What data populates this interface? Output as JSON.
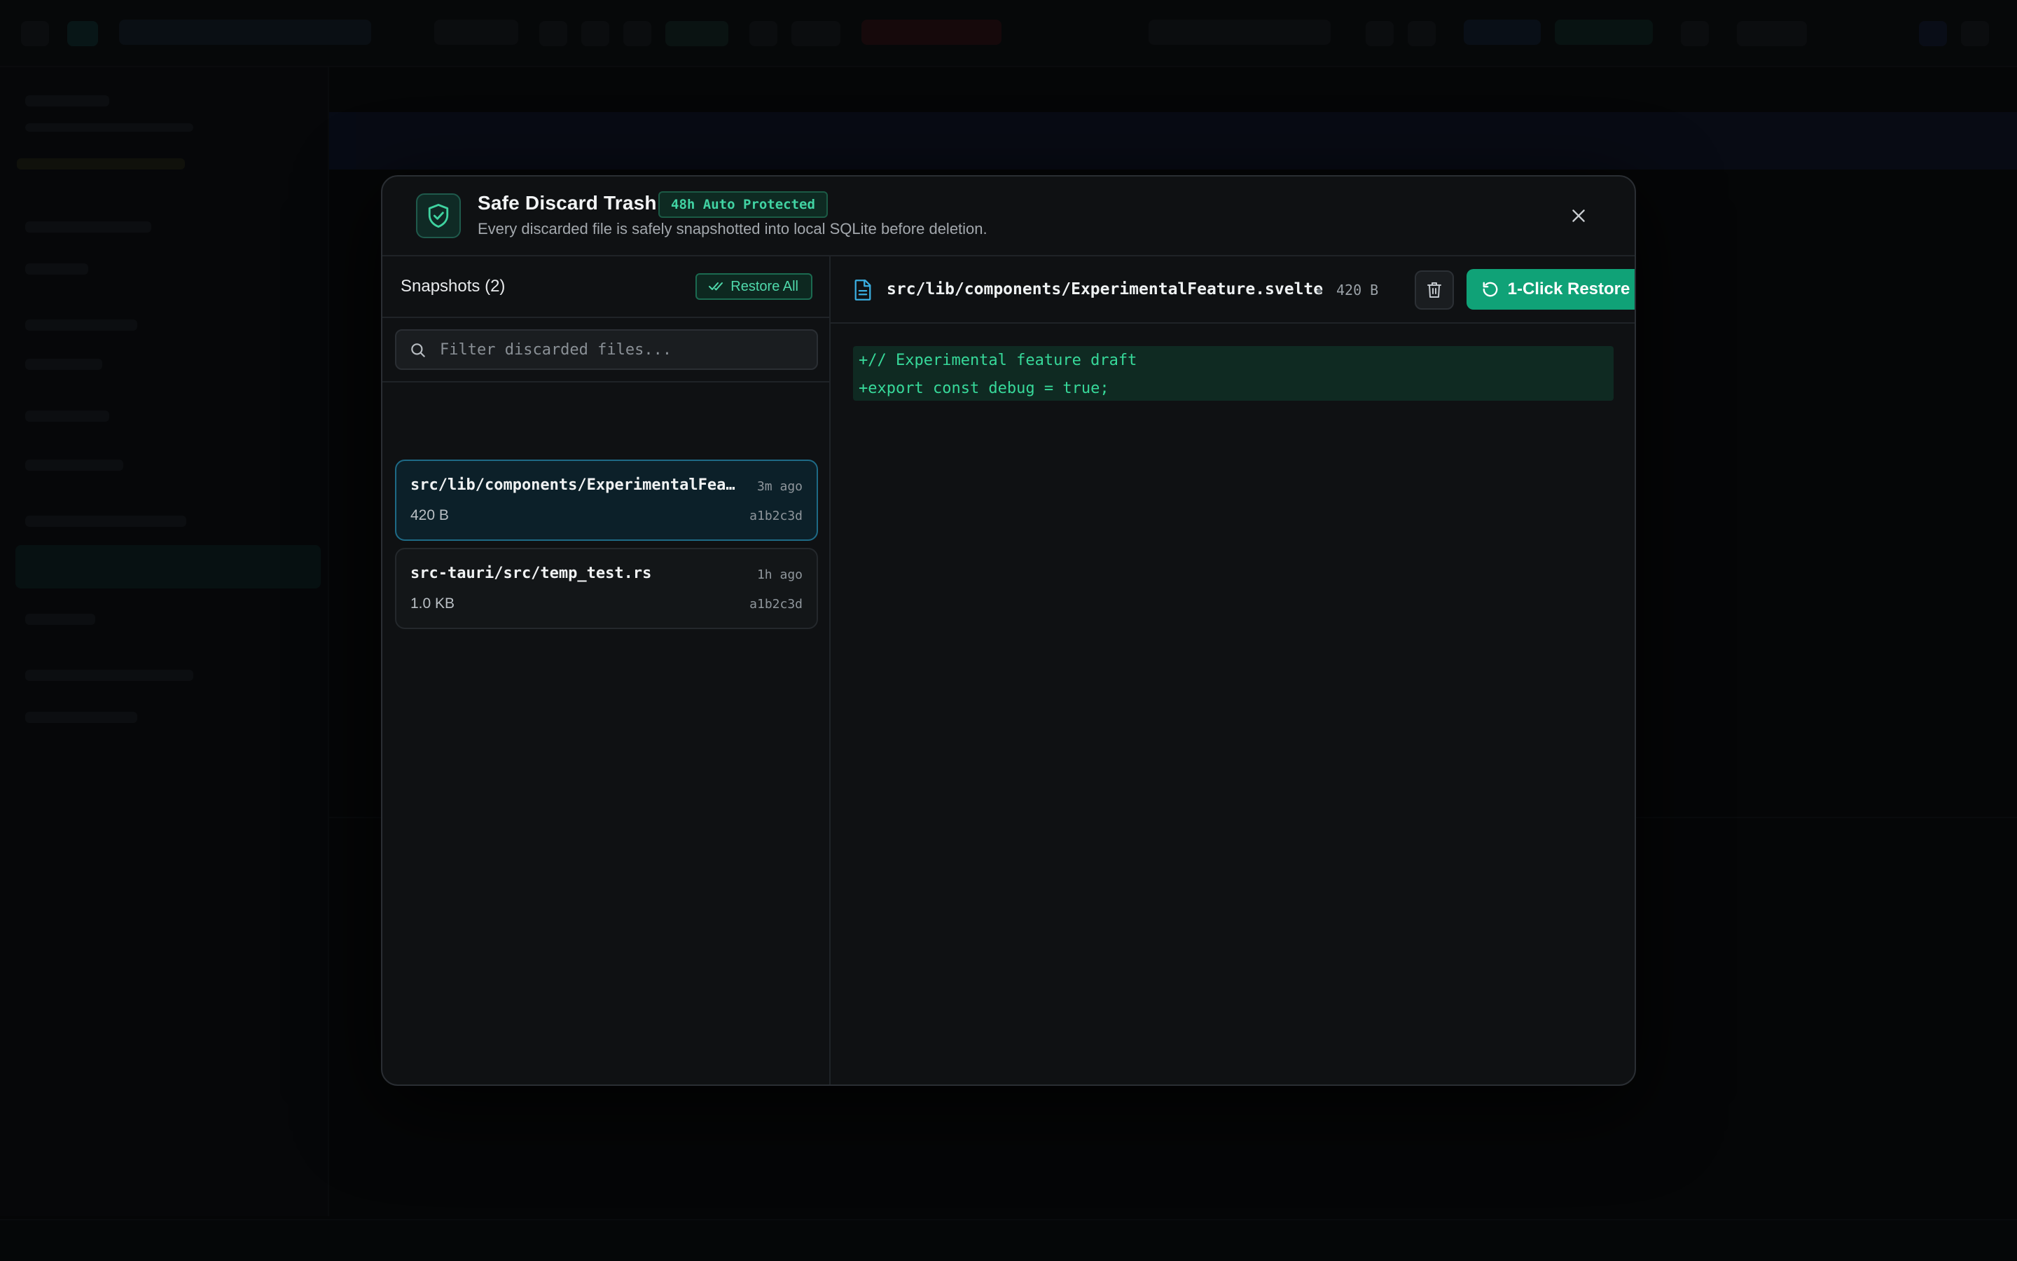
{
  "modal": {
    "title": "Safe Discard Trash",
    "badge": "48h Auto Protected",
    "subtitle": "Every discarded file is safely snapshotted into local SQLite before deletion.",
    "close_icon": "close-icon",
    "shield_icon": "shield-check-icon"
  },
  "snapshots": {
    "title": "Snapshots (2)",
    "restore_all_label": "Restore All",
    "filter_placeholder": "Filter discarded files...",
    "items": [
      {
        "name": "src/lib/components/ExperimentalFeature.svelte",
        "time": "3m ago",
        "size": "420 B",
        "hash": "a1b2c3d",
        "selected": true
      },
      {
        "name": "src-tauri/src/temp_test.rs",
        "time": "1h ago",
        "size": "1.0 KB",
        "hash": "a1b2c3d",
        "selected": false
      }
    ]
  },
  "preview": {
    "file_path": "src/lib/components/ExperimentalFeature.svelte",
    "file_size": "420 B",
    "restore_label": "1-Click Restore",
    "diff_lines": [
      "+// Experimental feature draft",
      "+export const debug = true;"
    ]
  },
  "colors": {
    "accent": "#10a277",
    "diff_add": "#37d99a",
    "badge_text": "#41d3a3",
    "selected_border": "#1e6a86"
  }
}
